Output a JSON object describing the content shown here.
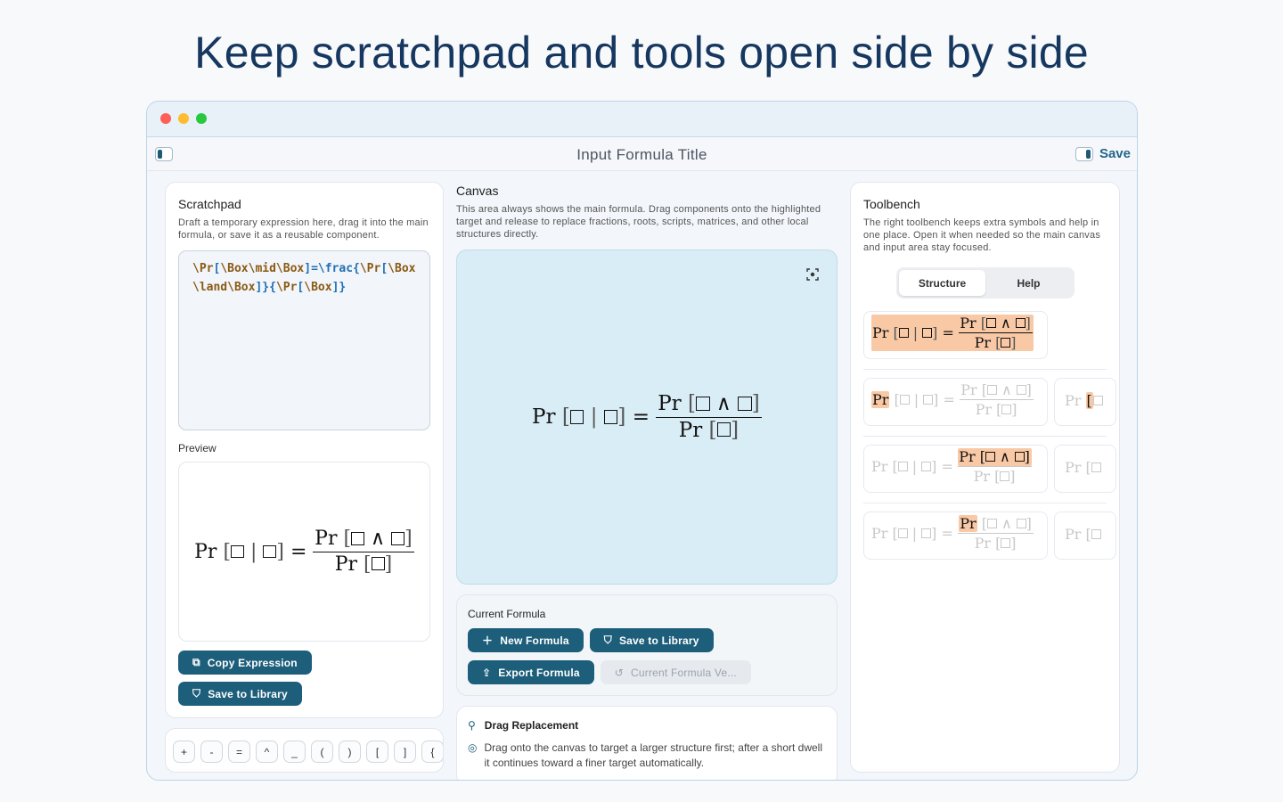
{
  "headline": "Keep scratchpad and tools open side by side",
  "window": {
    "title": "Input Formula Title",
    "save_label": "Save"
  },
  "scratchpad": {
    "title": "Scratchpad",
    "description": "Draft a temporary expression here, drag it into the main formula, or save it as a reusable component.",
    "code": {
      "p1": "\\Pr",
      "p2": "[",
      "p3": "\\Box\\mid\\Box",
      "p4": "]",
      "p5": "=",
      "p6": "\\frac",
      "p7": "{",
      "p8": "\\Pr",
      "p9": "[",
      "p10": "\\Box\\land\\Box",
      "p11": "]",
      "p12": "}{",
      "p13": "\\Pr",
      "p14": "[",
      "p15": "\\Box",
      "p16": "]}"
    },
    "preview_label": "Preview",
    "copy_label": "Copy Expression",
    "save_label": "Save to Library"
  },
  "keys": [
    "+",
    "-",
    "=",
    "^",
    "_",
    "(",
    ")",
    "[",
    "]",
    "{"
  ],
  "canvas": {
    "title": "Canvas",
    "description": "This area always shows the main formula. Drag components onto the highlighted target and release to replace fractions, roots, scripts, matrices, and other local structures directly."
  },
  "formula": {
    "pr": "Pr",
    "lb": "[",
    "rb": "]",
    "mid": "|",
    "land": "∧",
    "eq": "="
  },
  "current_formula": {
    "title": "Current Formula",
    "new_label": "New Formula",
    "save_label": "Save to Library",
    "export_label": "Export Formula",
    "versions_label": "Current Formula Ve..."
  },
  "drag_replacement": {
    "title": "Drag Replacement",
    "text": "Drag onto the canvas to target a larger structure first; after a short dwell it continues toward a finer target automatically."
  },
  "toolbench": {
    "title": "Toolbench",
    "description": "The right toolbench keeps extra symbols and help in one place. Open it when needed so the main canvas and input area stay focused.",
    "tabs": [
      "Structure",
      "Help"
    ],
    "active_tab": "Structure"
  },
  "colors": {
    "primary": "#1d5e7b",
    "canvas_bg": "#d9edf6",
    "highlight": "#f9c9a6",
    "headline": "#16375f"
  }
}
